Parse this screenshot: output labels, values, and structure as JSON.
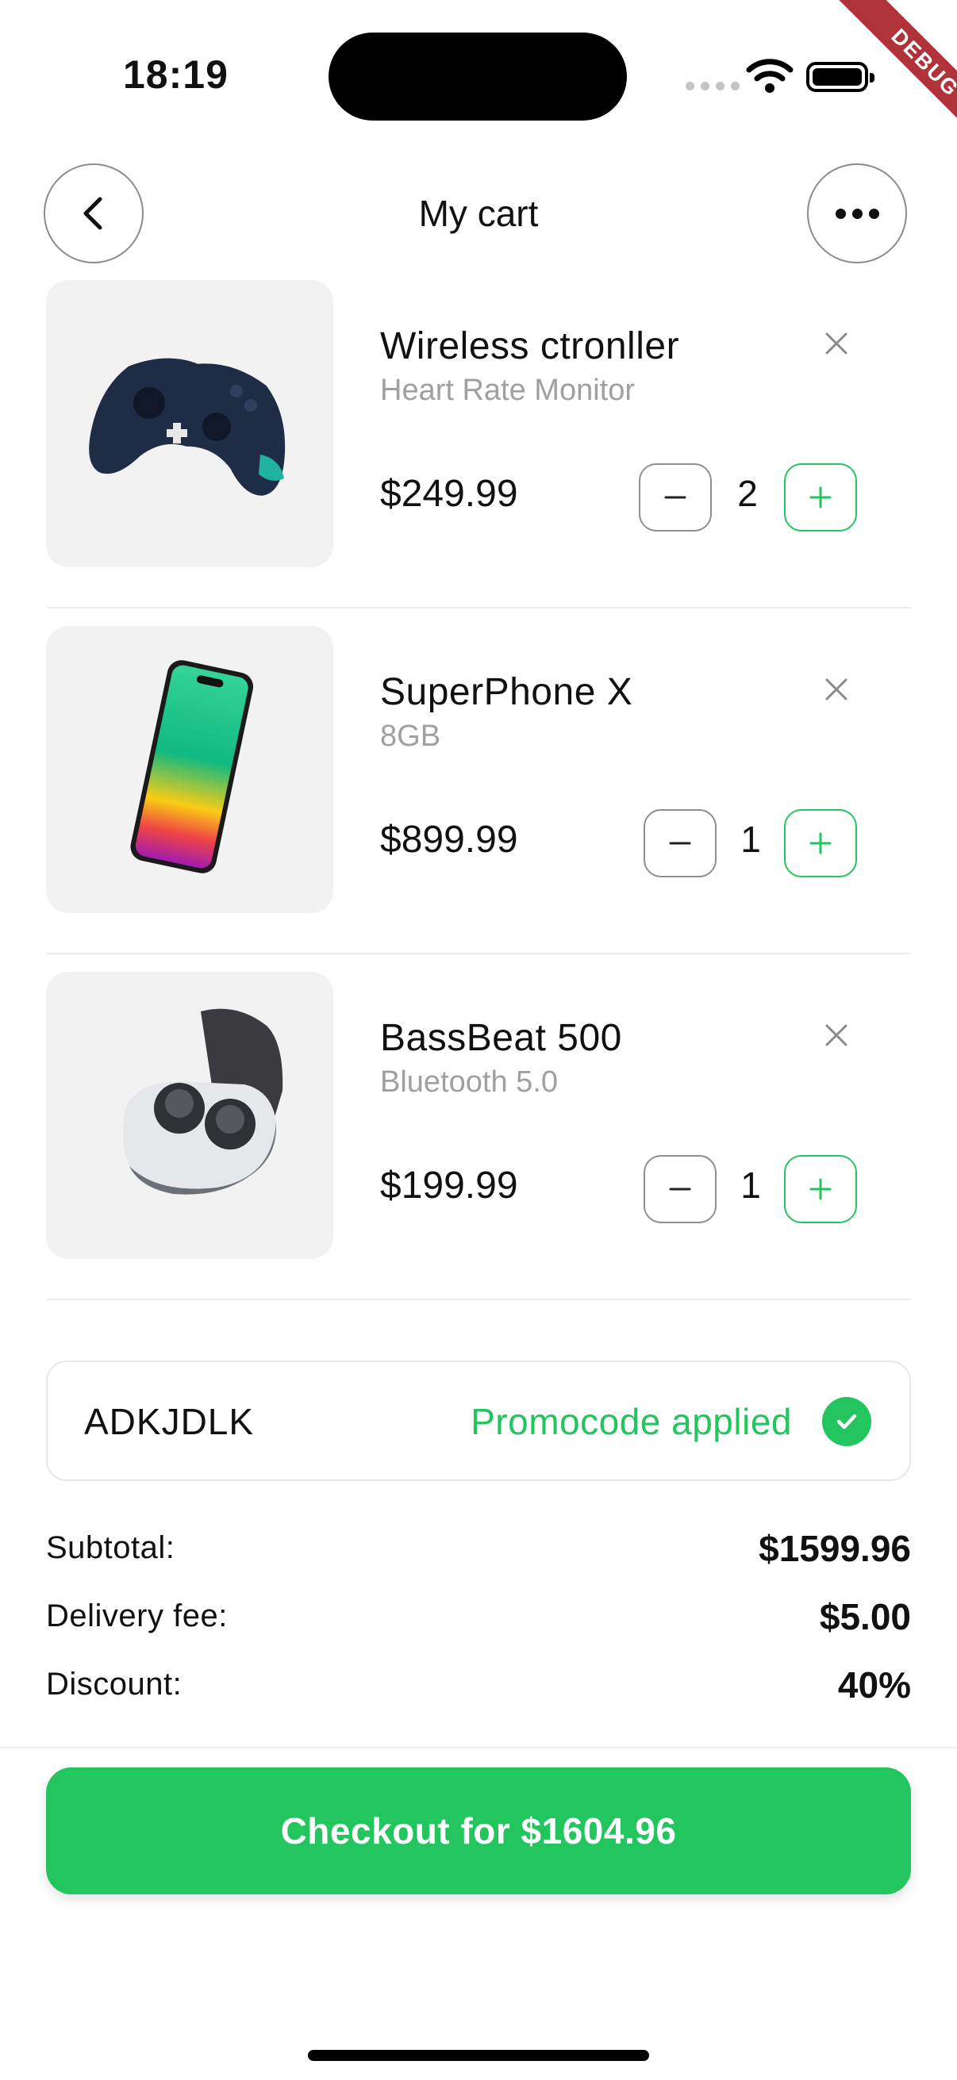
{
  "status_bar": {
    "time": "18:19",
    "debug_label": "DEBUG"
  },
  "header": {
    "title": "My cart"
  },
  "items": [
    {
      "name": "Wireless ctronller",
      "variant": "Heart Rate Monitor",
      "price": "$249.99",
      "quantity": "2"
    },
    {
      "name": "SuperPhone X",
      "variant": "8GB",
      "price": "$899.99",
      "quantity": "1"
    },
    {
      "name": "BassBeat 500",
      "variant": "Bluetooth 5.0",
      "price": "$199.99",
      "quantity": "1"
    }
  ],
  "promo": {
    "code": "ADKJDLK",
    "status": "Promocode applied"
  },
  "summary": {
    "subtotal_label": "Subtotal:",
    "subtotal_value": "$1599.96",
    "delivery_label": "Delivery fee:",
    "delivery_value": "$5.00",
    "discount_label": "Discount:",
    "discount_value": "40%"
  },
  "checkout": {
    "label": "Checkout for $1604.96"
  },
  "colors": {
    "accent": "#22c55e",
    "thumb_bg": "#f2f2f2",
    "muted_text": "#a0a0a0",
    "debug_banner": "#b0333a"
  }
}
